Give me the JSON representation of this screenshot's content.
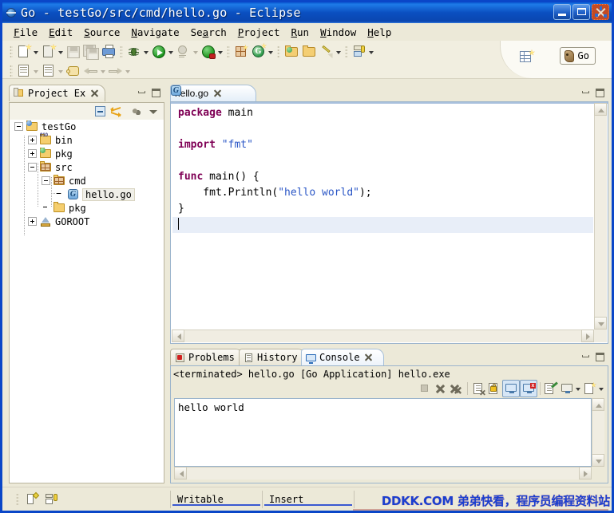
{
  "window": {
    "title": "Go - testGo/src/cmd/hello.go - Eclipse",
    "icon": "eclipse-globe-icon",
    "controls": {
      "minimize": "minimize-button",
      "restore": "restore-button",
      "close": "close-button"
    }
  },
  "menubar": {
    "items": [
      {
        "label": "File",
        "mnemonic": "F"
      },
      {
        "label": "Edit",
        "mnemonic": "E"
      },
      {
        "label": "Source",
        "mnemonic": "S"
      },
      {
        "label": "Navigate",
        "mnemonic": "N"
      },
      {
        "label": "Search",
        "mnemonic": "a"
      },
      {
        "label": "Project",
        "mnemonic": "P"
      },
      {
        "label": "Run",
        "mnemonic": "R"
      },
      {
        "label": "Window",
        "mnemonic": "W"
      },
      {
        "label": "Help",
        "mnemonic": "H"
      }
    ]
  },
  "toolbar": {
    "row1": [
      {
        "name": "new-wizard-icon",
        "enabled": true,
        "dropdown": true
      },
      {
        "name": "new-editor-icon",
        "enabled": true,
        "dropdown": true
      },
      {
        "name": "save-icon",
        "enabled": false,
        "dropdown": false
      },
      {
        "name": "save-all-icon",
        "enabled": false,
        "dropdown": false
      },
      {
        "name": "print-icon",
        "enabled": true,
        "dropdown": false
      },
      {
        "name": "debug-icon",
        "enabled": true,
        "dropdown": true
      },
      {
        "name": "run-icon",
        "enabled": true,
        "dropdown": true
      },
      {
        "name": "profile-icon",
        "enabled": false,
        "dropdown": true
      },
      {
        "name": "external-tools-icon",
        "enabled": true,
        "dropdown": true
      },
      {
        "name": "new-go-package-icon",
        "enabled": true,
        "dropdown": false
      },
      {
        "name": "new-go-file-icon",
        "enabled": true,
        "dropdown": true
      },
      {
        "name": "open-resource-icon",
        "enabled": true,
        "dropdown": false
      },
      {
        "name": "open-folder-icon",
        "enabled": true,
        "dropdown": false
      },
      {
        "name": "build-icon",
        "enabled": true,
        "dropdown": true
      },
      {
        "name": "server-icon",
        "enabled": true,
        "dropdown": true
      }
    ],
    "row2": [
      {
        "name": "previous-annotation-icon",
        "enabled": false,
        "dropdown": true
      },
      {
        "name": "next-annotation-icon",
        "enabled": false,
        "dropdown": true
      },
      {
        "name": "last-edit-location-icon",
        "enabled": true,
        "dropdown": false
      },
      {
        "name": "back-icon",
        "enabled": false,
        "dropdown": true
      },
      {
        "name": "forward-icon",
        "enabled": false,
        "dropdown": true
      }
    ],
    "perspective": {
      "open_perspective": "open-perspective-icon",
      "active_label": "Go",
      "active_icon": "go-gopher-icon"
    }
  },
  "project_explorer": {
    "tab_label": "Project Ex",
    "tab_icon": "project-explorer-icon",
    "view_toolbar": [
      {
        "name": "collapse-all-icon"
      },
      {
        "name": "link-with-editor-icon"
      },
      {
        "name": "view-menu-dots-icon"
      },
      {
        "name": "view-menu-chevron-icon"
      }
    ],
    "tree": [
      {
        "label": "testGo",
        "depth": 0,
        "state": "expanded",
        "icon": "go-project-icon"
      },
      {
        "label": "bin",
        "depth": 1,
        "state": "collapsed",
        "icon": "bin-folder-icon"
      },
      {
        "label": "pkg",
        "depth": 1,
        "state": "collapsed",
        "icon": "pkg-folder-icon"
      },
      {
        "label": "src",
        "depth": 1,
        "state": "expanded",
        "icon": "src-folder-icon"
      },
      {
        "label": "cmd",
        "depth": 2,
        "state": "expanded",
        "icon": "package-folder-icon"
      },
      {
        "label": "hello.go",
        "depth": 3,
        "state": "leaf",
        "icon": "go-file-icon",
        "selected": true
      },
      {
        "label": "pkg",
        "depth": 2,
        "state": "leaf",
        "icon": "plain-folder-icon"
      },
      {
        "label": "GOROOT",
        "depth": 1,
        "state": "collapsed",
        "icon": "goroot-icon"
      }
    ]
  },
  "editor": {
    "tab_label": "hello.go",
    "tab_icon": "go-file-icon",
    "code_lines": [
      {
        "segments": [
          {
            "t": "package",
            "c": "kw"
          },
          {
            "t": " main",
            "c": ""
          }
        ]
      },
      {
        "segments": []
      },
      {
        "segments": [
          {
            "t": "import",
            "c": "kw"
          },
          {
            "t": " ",
            "c": ""
          },
          {
            "t": "\"fmt\"",
            "c": "str"
          }
        ]
      },
      {
        "segments": []
      },
      {
        "segments": [
          {
            "t": "func",
            "c": "kw"
          },
          {
            "t": " main() {",
            "c": ""
          }
        ]
      },
      {
        "segments": [
          {
            "t": "    fmt.Println(",
            "c": ""
          },
          {
            "t": "\"hello world\"",
            "c": "str"
          },
          {
            "t": ");",
            "c": ""
          }
        ]
      },
      {
        "segments": [
          {
            "t": "}",
            "c": ""
          }
        ]
      },
      {
        "segments": [],
        "caret": true
      }
    ]
  },
  "console": {
    "tabs": [
      {
        "label": "Problems",
        "icon": "problems-icon",
        "active": false
      },
      {
        "label": "History",
        "icon": "history-icon",
        "active": false
      },
      {
        "label": "Console",
        "icon": "console-icon",
        "active": true
      }
    ],
    "process_line": "<terminated> hello.go [Go Application] hello.exe",
    "toolbar": [
      {
        "name": "terminate-icon",
        "enabled": false,
        "toggled": false
      },
      {
        "name": "remove-launch-icon",
        "enabled": true,
        "toggled": false
      },
      {
        "name": "remove-all-terminated-icon",
        "enabled": true,
        "toggled": false
      },
      {
        "name": "clear-console-icon",
        "enabled": true,
        "toggled": false
      },
      {
        "name": "scroll-lock-icon",
        "enabled": true,
        "toggled": false
      },
      {
        "name": "show-console-on-output-icon",
        "enabled": true,
        "toggled": true
      },
      {
        "name": "show-console-on-error-icon",
        "enabled": true,
        "toggled": true
      },
      {
        "name": "pin-console-icon",
        "enabled": true,
        "toggled": false
      },
      {
        "name": "display-selected-console-icon",
        "enabled": true,
        "toggled": false
      },
      {
        "name": "open-console-icon",
        "enabled": true,
        "toggled": false
      }
    ],
    "output": "hello world"
  },
  "statusbar": {
    "left_icons": [
      {
        "name": "writable-indicator-icon"
      },
      {
        "name": "build-state-icon"
      }
    ],
    "writable": "Writable",
    "insert_mode": "Insert",
    "watermark": "DDKK.COM 弟弟快看，程序员编程资料站"
  },
  "colors": {
    "title_bar": "#0A4FC0",
    "chrome": "#ECE9D8",
    "keyword": "#7F0055",
    "string": "#2A56C6",
    "current_line": "#E8EEF8",
    "watermark": "#1A3FD0"
  }
}
